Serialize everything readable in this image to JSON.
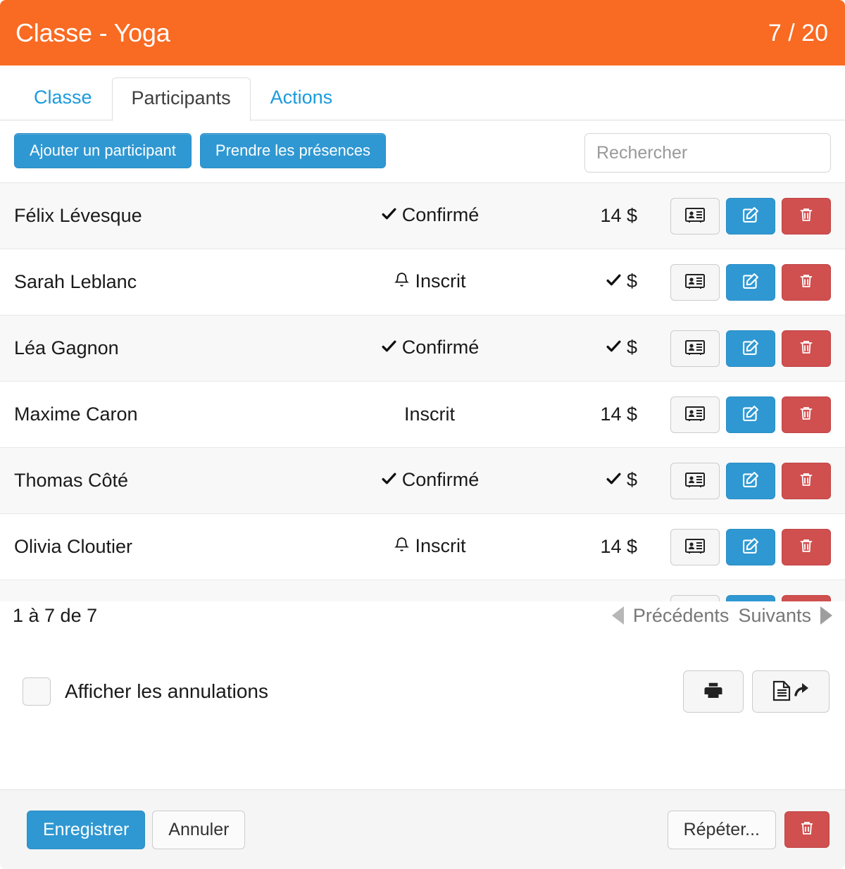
{
  "header": {
    "title": "Classe - Yoga",
    "count": "7 / 20",
    "accent_color": "#f96a22"
  },
  "tabs": [
    {
      "label": "Classe",
      "active": false
    },
    {
      "label": "Participants",
      "active": true
    },
    {
      "label": "Actions",
      "active": false
    }
  ],
  "toolbar": {
    "add_participant_label": "Ajouter un participant",
    "take_attendance_label": "Prendre les présences",
    "search_placeholder": "Rechercher",
    "search_value": ""
  },
  "table": {
    "rows": [
      {
        "name": "Félix Lévesque",
        "status_icon": "check",
        "status": "Confirmé",
        "price_icon": "",
        "price": "14 $"
      },
      {
        "name": "Sarah Leblanc",
        "status_icon": "bell",
        "status": "Inscrit",
        "price_icon": "check",
        "price": "$"
      },
      {
        "name": "Léa Gagnon",
        "status_icon": "check",
        "status": "Confirmé",
        "price_icon": "check",
        "price": "$"
      },
      {
        "name": "Maxime Caron",
        "status_icon": "",
        "status": "Inscrit",
        "price_icon": "",
        "price": "14 $"
      },
      {
        "name": "Thomas Côté",
        "status_icon": "check",
        "status": "Confirmé",
        "price_icon": "check",
        "price": "$"
      },
      {
        "name": "Olivia Cloutier",
        "status_icon": "bell",
        "status": "Inscrit",
        "price_icon": "",
        "price": "14 $"
      },
      {
        "name": "",
        "status_icon": "bell",
        "status": "",
        "price_icon": "",
        "price": ""
      }
    ],
    "action_icons": {
      "card": "contact-card-icon",
      "edit": "pencil-edit-icon",
      "delete": "trash-icon"
    }
  },
  "pagination": {
    "info": "1 à 7 de 7",
    "previous_label": "Précédents",
    "next_label": "Suivants"
  },
  "options": {
    "show_cancellations_label": "Afficher les annulations",
    "show_cancellations_checked": false,
    "print_icon": "printer-icon",
    "export_icon": "document-export-icon"
  },
  "footer": {
    "save_label": "Enregistrer",
    "cancel_label": "Annuler",
    "repeat_label": "Répéter...",
    "delete_icon": "trash-icon"
  },
  "colors": {
    "orange": "#f96a22",
    "blue": "#2f98d2",
    "link_blue": "#1a9bdc",
    "red": "#d04f4f",
    "row_alt": "#f8f8f8"
  }
}
